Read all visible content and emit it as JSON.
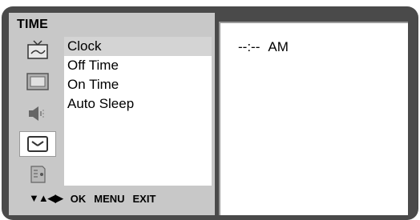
{
  "menu": {
    "title": "TIME",
    "icons": [
      {
        "name": "picture-icon",
        "selected": false
      },
      {
        "name": "screen-icon",
        "selected": false
      },
      {
        "name": "sound-icon",
        "selected": false
      },
      {
        "name": "clock-icon",
        "selected": true
      },
      {
        "name": "options-icon",
        "selected": false
      }
    ],
    "items": [
      {
        "label": "Clock",
        "highlighted": true
      },
      {
        "label": "Off Time",
        "highlighted": false
      },
      {
        "label": "On Time",
        "highlighted": false
      },
      {
        "label": "Auto Sleep",
        "highlighted": false
      }
    ]
  },
  "nav": {
    "arrows": "▼▲◀▶",
    "ok": "OK",
    "menu": "MENU",
    "exit": "EXIT"
  },
  "clock": {
    "time": "--:--",
    "period": "AM"
  }
}
